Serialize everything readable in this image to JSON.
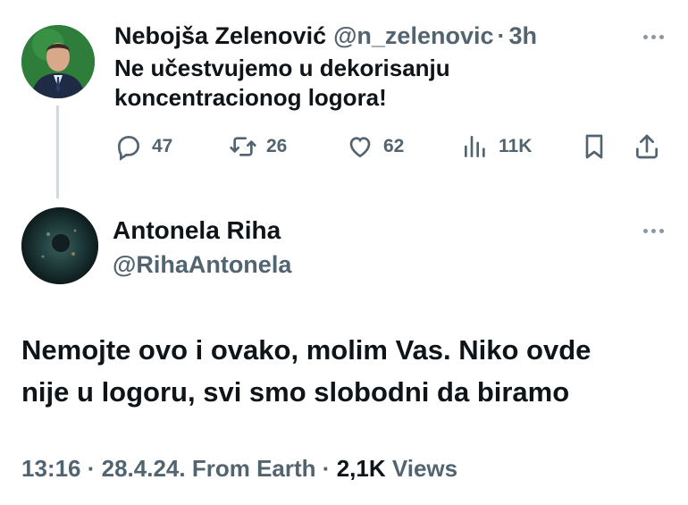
{
  "tweet1": {
    "author_name": "Nebojša Zelenović",
    "handle": "@n_zelenovic",
    "separator": "·",
    "time": "3h",
    "text_line1": "Ne učestvujemo u dekorisanju",
    "text_line2": "koncentracionog logora!",
    "actions": {
      "replies": "47",
      "retweets": "26",
      "likes": "62",
      "views": "11K"
    }
  },
  "tweet2": {
    "author_name": "Antonela Riha",
    "handle": "@RihaAntonela",
    "text_line1": "Nemojte ovo i ovako, molim Vas. Niko ovde",
    "text_line2": "nije u logoru, svi smo slobodni da biramo",
    "meta": {
      "time": "13:16",
      "date": "28.4.24.",
      "source": "From Earth",
      "separator": "·",
      "views_count": "2,1K",
      "views_label": "Views"
    }
  },
  "colors": {
    "text_primary": "#0f1419",
    "text_secondary": "#536471",
    "thread_line": "#cfd9de",
    "background": "#ffffff"
  },
  "icons": [
    "reply-icon",
    "retweet-icon",
    "like-icon",
    "views-icon",
    "bookmark-icon",
    "share-icon",
    "more-icon"
  ]
}
